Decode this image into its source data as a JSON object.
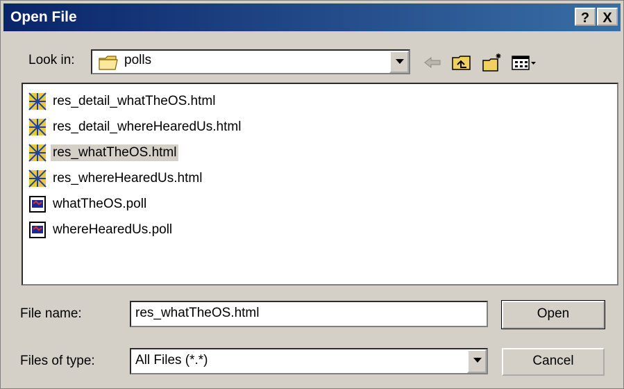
{
  "title_bar": {
    "title": "Open File",
    "help_label": "?",
    "close_label": "X"
  },
  "look_in": {
    "label": "Look in:",
    "value": "polls"
  },
  "toolbar": {
    "icons": [
      "back-arrow-icon",
      "up-folder-icon",
      "new-folder-icon",
      "view-menu-icon"
    ]
  },
  "files": [
    {
      "name": "res_detail_whatTheOS.html",
      "icon": "html-file-icon",
      "selected": false
    },
    {
      "name": "res_detail_whereHearedUs.html",
      "icon": "html-file-icon",
      "selected": false
    },
    {
      "name": "res_whatTheOS.html",
      "icon": "html-file-icon",
      "selected": true
    },
    {
      "name": "res_whereHearedUs.html",
      "icon": "html-file-icon",
      "selected": false
    },
    {
      "name": "whatTheOS.poll",
      "icon": "poll-file-icon",
      "selected": false
    },
    {
      "name": "whereHearedUs.poll",
      "icon": "poll-file-icon",
      "selected": false
    }
  ],
  "file_name": {
    "label": "File name:",
    "value": "res_whatTheOS.html"
  },
  "file_type": {
    "label": "Files of type:",
    "value": "All Files (*.*)"
  },
  "buttons": {
    "open": "Open",
    "cancel": "Cancel"
  },
  "colors": {
    "title_start": "#0a246a",
    "title_end": "#3a6ea5",
    "face": "#d4d0c8"
  }
}
